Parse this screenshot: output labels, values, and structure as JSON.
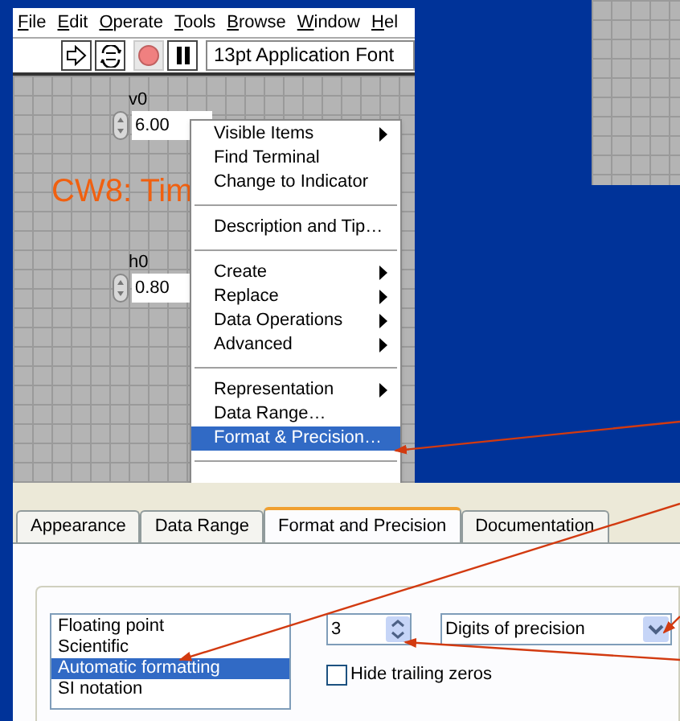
{
  "menu_bar": [
    {
      "label": "File"
    },
    {
      "label": "Edit"
    },
    {
      "label": "Operate"
    },
    {
      "label": "Tools"
    },
    {
      "label": "Browse"
    },
    {
      "label": "Window"
    },
    {
      "label": "Hel"
    }
  ],
  "toolbar": {
    "font": "13pt Application Font"
  },
  "canvas": {
    "controls": [
      {
        "label": "v0",
        "value": "6.00"
      },
      {
        "label": "h0",
        "value": "0.80"
      }
    ],
    "title": "CW8: Tim"
  },
  "context_menu": [
    {
      "kind": "item",
      "label": "Visible Items",
      "submenu": true,
      "selected": false
    },
    {
      "kind": "item",
      "label": "Find Terminal",
      "submenu": false,
      "selected": false
    },
    {
      "kind": "item",
      "label": "Change to Indicator",
      "submenu": false,
      "selected": false
    },
    {
      "kind": "separator"
    },
    {
      "kind": "item",
      "label": "Description and Tip…",
      "submenu": false,
      "selected": false
    },
    {
      "kind": "separator"
    },
    {
      "kind": "item",
      "label": "Create",
      "submenu": true,
      "selected": false
    },
    {
      "kind": "item",
      "label": "Replace",
      "submenu": true,
      "selected": false
    },
    {
      "kind": "item",
      "label": "Data Operations",
      "submenu": true,
      "selected": false
    },
    {
      "kind": "item",
      "label": "Advanced",
      "submenu": true,
      "selected": false
    },
    {
      "kind": "separator"
    },
    {
      "kind": "item",
      "label": "Representation",
      "submenu": true,
      "selected": false
    },
    {
      "kind": "item",
      "label": "Data Range…",
      "submenu": false,
      "selected": false
    },
    {
      "kind": "item",
      "label": "Format & Precision…",
      "submenu": false,
      "selected": true
    },
    {
      "kind": "separator"
    }
  ],
  "dialog": {
    "tabs": [
      {
        "label": "Appearance",
        "selected": false
      },
      {
        "label": "Data Range",
        "selected": false
      },
      {
        "label": "Format and Precision",
        "selected": true
      },
      {
        "label": "Documentation",
        "selected": false
      }
    ],
    "formats": [
      {
        "label": "Floating point",
        "selected": false
      },
      {
        "label": "Scientific",
        "selected": false
      },
      {
        "label": "Automatic formatting",
        "selected": true
      },
      {
        "label": "SI notation",
        "selected": false
      }
    ],
    "digits": "3",
    "precision_type": "Digits of precision",
    "hide_trailing_zeros": {
      "label": "Hide trailing zeros",
      "checked": false
    }
  }
}
